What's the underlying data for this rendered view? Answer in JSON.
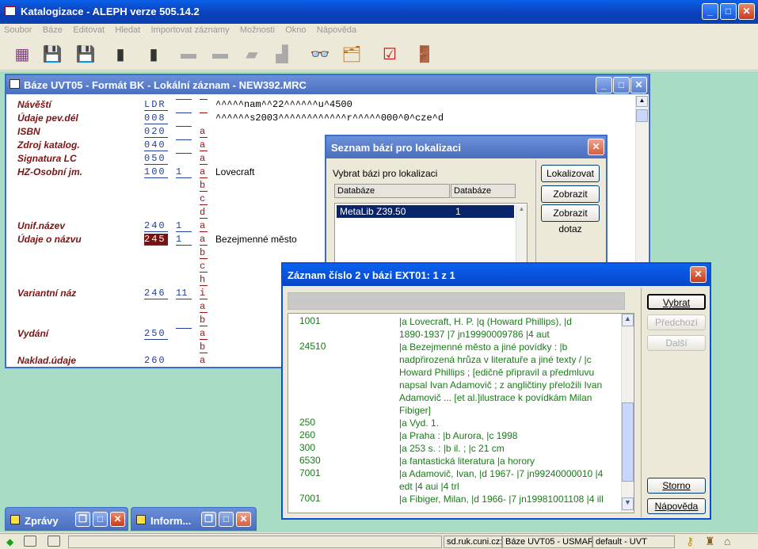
{
  "app": {
    "title": "Katalogizace - ALEPH verze 505.14.2"
  },
  "menu": [
    "Soubor",
    "Báze",
    "Editovat",
    "Hledat",
    "Importovat záznamy",
    "Možnosti",
    "Okno",
    "Nápověda"
  ],
  "record_window": {
    "title": "Báze UVT05 - Formát BK - Lokální záznam - NEW392.MRC",
    "fields": [
      {
        "label": "Návěští",
        "tag": "LDR",
        "ind": "",
        "subs": [],
        "value": "^^^^^nam^^22^^^^^^u^4500"
      },
      {
        "label": "Údaje pev.dél",
        "tag": "008",
        "ind": "",
        "subs": [],
        "value": "^^^^^^s2003^^^^^^^^^^^^r^^^^^000^0^cze^d"
      },
      {
        "label": "ISBN",
        "tag": "020",
        "ind": "",
        "subs": [
          "a"
        ],
        "value": ""
      },
      {
        "label": "Zdroj katalog.",
        "tag": "040",
        "ind": "",
        "subs": [
          "a"
        ],
        "value": ""
      },
      {
        "label": "Signatura LC",
        "tag": "050",
        "ind": "",
        "subs": [
          "a"
        ],
        "value": ""
      },
      {
        "label": "HZ-Osobní jm.",
        "tag": "100",
        "ind": "1",
        "subs": [
          "a",
          "b",
          "c",
          "d"
        ],
        "value": "Lovecraft"
      },
      {
        "label": "Unif.název",
        "tag": "240",
        "ind": "1",
        "subs": [
          "a"
        ],
        "value": ""
      },
      {
        "label": "Údaje o názvu",
        "tag": "245",
        "ind": "1",
        "subs": [
          "a",
          "b",
          "c",
          "h"
        ],
        "value": "Bezejmenné město"
      },
      {
        "label": "Variantní náz",
        "tag": "246",
        "ind": "11",
        "subs": [
          "i",
          "a",
          "b"
        ],
        "value": ""
      },
      {
        "label": "Vydání",
        "tag": "250",
        "ind": "",
        "subs": [
          "a",
          "b"
        ],
        "value": ""
      },
      {
        "label": "Naklad.údaje",
        "tag": "260",
        "ind": "",
        "subs": [
          "a"
        ],
        "value": ""
      }
    ]
  },
  "db_window": {
    "title": "Seznam bází pro lokalizaci",
    "prompt": "Vybrat bázi pro lokalizaci",
    "col1": "Databáze",
    "col2": "Databáze",
    "row": {
      "name": "MetaLib Z39.50",
      "num": "1"
    },
    "buttons": [
      "Lokalizovat",
      "Zobrazit zázn.",
      "Zobrazit dotaz"
    ]
  },
  "ext_window": {
    "title": "Záznam číslo 2 v bázi EXT01: 1 z 1",
    "rows": [
      {
        "tag": "1001",
        "lines": [
          "|a Lovecraft, H. P. |q (Howard Phillips), |d",
          "1890-1937 |7 jn19990009786 |4 aut"
        ]
      },
      {
        "tag": "24510",
        "lines": [
          "|a Bezejmenné město a jiné povídky : |b",
          "nadpřirozená hrůza v literatuře a jiné texty / |c",
          "Howard Phillips ; [edičně připravil a předmluvu",
          "napsal Ivan Adamovič ; z angličtiny přeložili Ivan",
          "Adamovič ... [et al.]ilustrace k povídkám Milan",
          "Fibiger]"
        ]
      },
      {
        "tag": "250",
        "lines": [
          "|a Vyd. 1."
        ]
      },
      {
        "tag": "260",
        "lines": [
          "|a Praha : |b Aurora, |c 1998"
        ]
      },
      {
        "tag": "300",
        "lines": [
          "|a 253 s. : |b il. ; |c 21 cm"
        ]
      },
      {
        "tag": "6530",
        "lines": [
          "|a fantastická literatura |a horory"
        ]
      },
      {
        "tag": "7001",
        "lines": [
          "|a Adamovič, Ivan, |d 1967- |7 jn99240000010 |4",
          "edt |4 aui |4 trl"
        ]
      },
      {
        "tag": "7001",
        "lines": [
          "|a Fibiger, Milan, |d 1966- |7 jn19981001108 |4 ill"
        ]
      }
    ],
    "buttons_top": [
      "Vybrat",
      "Předchozí",
      "Další"
    ],
    "buttons_bottom": [
      "Storno",
      "Nápověda"
    ]
  },
  "minimized": [
    "Zprávy",
    "Inform..."
  ],
  "status": {
    "server": "sd.ruk.cuni.cz:",
    "base": "Báze UVT05 - USMARC",
    "profile": "default - UVT"
  }
}
